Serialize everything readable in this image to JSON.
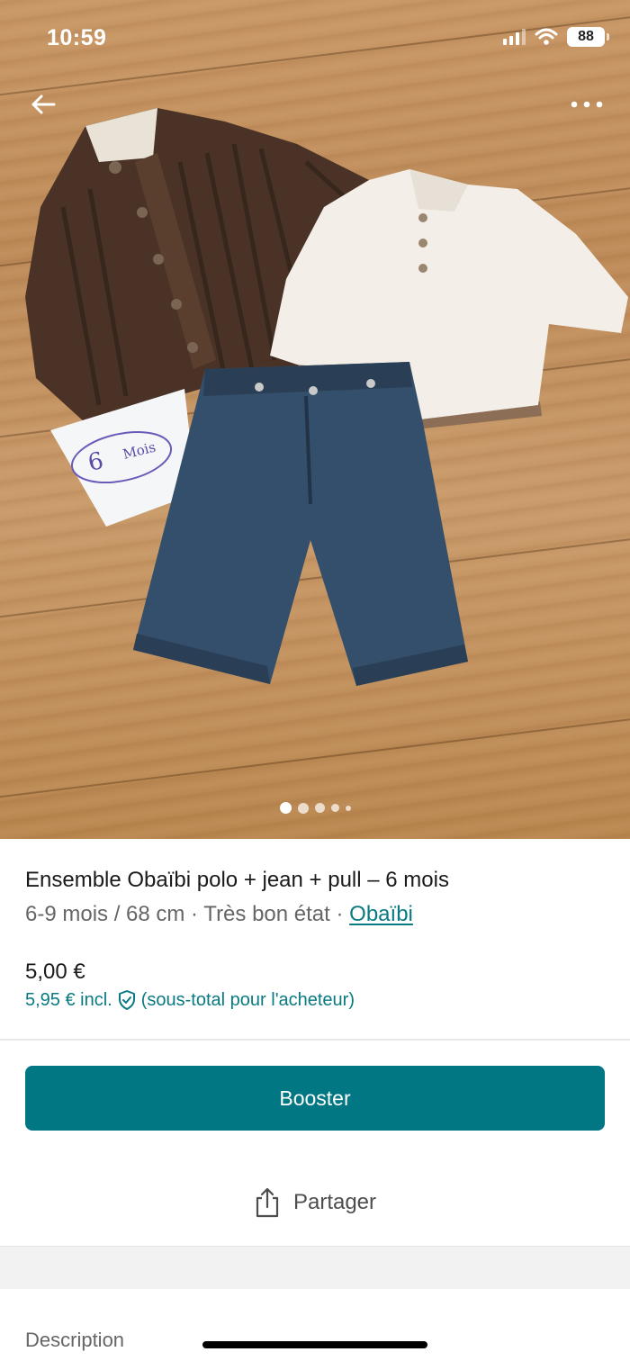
{
  "status_bar": {
    "time": "10:59",
    "battery": "88"
  },
  "gallery": {
    "image_count": 5,
    "active_index": 0,
    "note_text": "6 mois"
  },
  "product": {
    "title": "Ensemble Obaïbi polo + jean + pull – 6 mois",
    "size": "6-9 mois / 68 cm",
    "separator": " · ",
    "condition": "Très bon état",
    "brand": "Obaïbi",
    "price": "5,00 €",
    "price_incl": "5,95 € incl.",
    "price_incl_note": "(sous-total pour l'acheteur)"
  },
  "actions": {
    "boost_label": "Booster",
    "share_label": "Partager"
  },
  "section": {
    "description_label": "Description"
  },
  "icons": {
    "back": "arrow-left-icon",
    "more": "more-horizontal-icon",
    "shield": "shield-check-icon",
    "share": "share-icon"
  },
  "colors": {
    "accent": "#007782",
    "link": "#0a7a82"
  }
}
